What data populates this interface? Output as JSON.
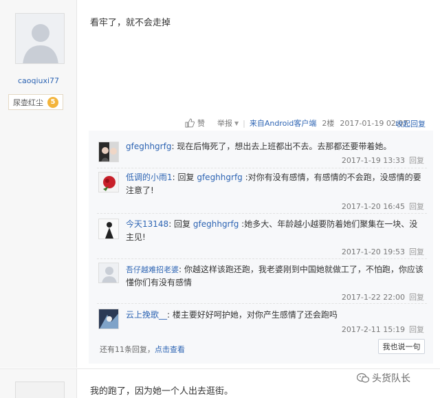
{
  "post1": {
    "username": "caoqiuxi77",
    "level_title": "尿壶红尘",
    "level_num": "5",
    "content": "看牢了，就不会走掉",
    "actions": {
      "like": "赞",
      "report": "举报",
      "source": "来自Android客户端",
      "floor": "2楼",
      "time": "2017-01-19 02:07",
      "collapse": "收起回复"
    }
  },
  "replies": [
    {
      "name": "gfeghhgrfg",
      "text": "现在后悔死了，想出去上班都出不去。去那都还要带着她。",
      "time": "2017-1-19 13:33",
      "reply": "回复"
    },
    {
      "name": "低调的小雨1",
      "prefix": "回复",
      "target": "gfeghhgrfg",
      "text": ":对你有没有感情，有感情的不会跑，没感情的要注意了!",
      "time": "2017-1-20 16:45",
      "reply": "回复"
    },
    {
      "name": "今天13148",
      "prefix": "回复",
      "target": "gfeghhgrfg",
      "text": ":她多大、年龄越小越要防着她们聚集在一块、没主见!",
      "time": "2017-1-20 19:53",
      "reply": "回复"
    },
    {
      "name": "吾仔越难招老婆",
      "text": "你越这样该跑还跑，我老婆刚到中国她就做工了，不怕跑，你应该懂你们有没有感情",
      "time": "2017-1-22 22:00",
      "reply": "回复"
    },
    {
      "name": "云上挽歌__",
      "text": "楼主要好好呵护她，对你产生感情了还会跑吗",
      "time": "2017-2-11 15:19",
      "reply": "回复"
    }
  ],
  "more": {
    "count_text": "还有11条回复，",
    "link": "点击查看",
    "say_button": "我也说一句"
  },
  "post2": {
    "content": "我的跑了，因为她一个人出去逛街。"
  },
  "watermark": "头货队长",
  "colors": {
    "link": "#2d64b3",
    "badge": "#f3b43b"
  }
}
